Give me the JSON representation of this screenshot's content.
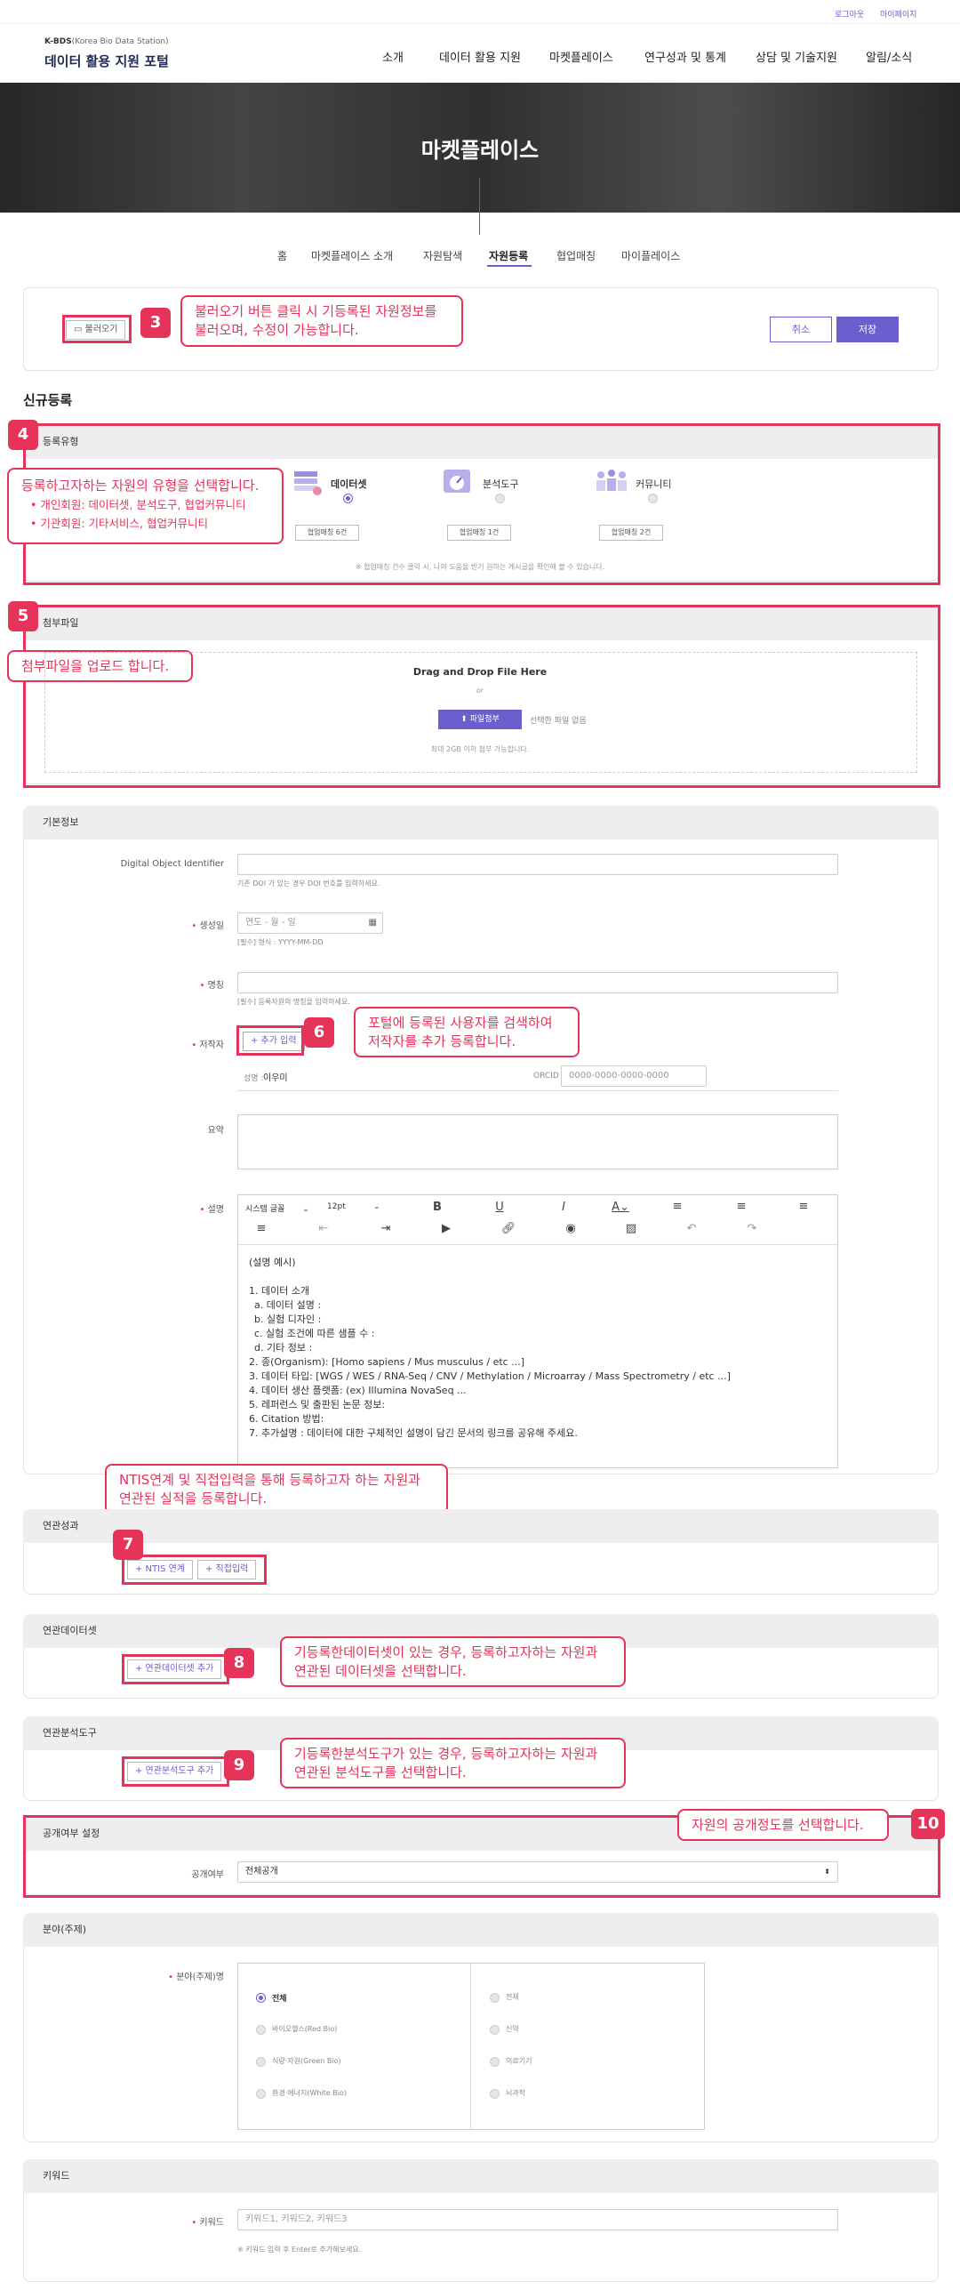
{
  "header": {
    "logout": "로그아웃",
    "mypage": "마이페이지",
    "brand_small": "K-BDS",
    "brand_sub": "(Korea Bio Data Station)",
    "brand_title": "데이터 활용 지원 포털",
    "nav": [
      "소개",
      "데이터 활용 지원",
      "마켓플레이스",
      "연구성과 및 통계",
      "상담 및 기술지원",
      "알림/소식"
    ]
  },
  "hero": {
    "title": "마켓플레이스"
  },
  "tabs": [
    "홈",
    "마켓플레이스 소개",
    "자원탐색",
    "자원등록",
    "협업매칭",
    "마이플레이스"
  ],
  "toolbar": {
    "load": "불러오기",
    "cancel": "취소",
    "save": "저장"
  },
  "callouts": {
    "c3": {
      "num": "3",
      "line1": "불러오기 버튼 클릭 시 기등록된 자원정보를",
      "line2": "불러오며, 수정이 가능합니다."
    },
    "c4": {
      "num": "4",
      "line1": "등록하고자하는 자원의 유형을 선택합니다.",
      "b1": "개인회원: 데이터셋, 분석도구, 협업커뮤니티",
      "b2": "기관회원: 기타서비스, 협업커뮤니티"
    },
    "c5": {
      "num": "5",
      "line1": "첨부파일을 업로드 합니다."
    },
    "c6": {
      "num": "6",
      "line1": "포털에 등록된 사용자를 검색하여",
      "line2": "저작자를 추가 등록합니다."
    },
    "c7": {
      "num": "7",
      "line1": "NTIS연계 및 직접입력을 통해 등록하고자 하는 자원과",
      "line2": "연관된 실적을 등록합니다."
    },
    "c8": {
      "num": "8",
      "line1": "기등록한데이터셋이 있는 경우, 등록하고자하는 자원과",
      "line2": "연관된 데이터셋을 선택합니다."
    },
    "c9": {
      "num": "9",
      "line1": "기등록한분석도구가 있는 경우, 등록하고자하는 자원과",
      "line2": "연관된 분석도구를 선택합니다."
    },
    "c10": {
      "num": "10",
      "line1": "자원의 공개정도를 선택합니다."
    }
  },
  "page_title": "신규등록",
  "reg_type": {
    "title": "등록유형",
    "items": [
      {
        "label": "데이터셋",
        "count": "협업매칭 6건"
      },
      {
        "label": "분석도구",
        "count": "협업매칭 1건"
      },
      {
        "label": "커뮤니티",
        "count": "협업매칭 2건"
      }
    ],
    "note": "※ 협업매칭 건수 클릭 시, 나의 도움을 받기 원하는 게시글을 확인해 볼 수 있습니다."
  },
  "attach": {
    "title": "첨부파일",
    "drag": "Drag and Drop File Here",
    "or": "or",
    "button": "파일첨부",
    "nofile": "선택한 파일 없음",
    "limit": "최대 2GB 이하 첨부 가능합니다."
  },
  "basic": {
    "title": "기본정보",
    "doi_label": "Digital Object Identifier",
    "doi_hint": "기존 DOI 가 있는 경우 DOI 번호를 입력하세요.",
    "date_label": "생성일",
    "date_ph": "연도 - 월 - 일",
    "date_hint": "[필수] 형식 : YYYY-MM-DD",
    "name_label": "명칭",
    "name_hint": "[필수] 등록자원의 명칭을 입력하세요.",
    "author_label": "저작자",
    "author_add": "+ 추가 입력",
    "author_name_label": "성명 :",
    "author_name": "이우미",
    "orcid_label": "ORCID :",
    "orcid_ph": "0000-0000-0000-0000",
    "summary_label": "요약",
    "desc_label": "설명",
    "editor_font": "시스템 글꼴",
    "editor_size": "12pt",
    "desc_lines": [
      "(설명 예시)",
      "",
      "1. 데이터 소개",
      "  a. 데이터 설명 :",
      "  b. 실험 디자인 :",
      "  c. 실험 조건에 따른 샘플 수 :",
      "  d. 기타 정보 :",
      "2. 종(Organism): [Homo sapiens / Mus musculus / etc ...]",
      "3. 데이터 타입: [WGS / WES / RNA-Seq / CNV / Methylation / Microarray / Mass Spectrometry / etc ...]",
      "4. 데이터 생산 플랫폼: (ex) Illumina NovaSeq ...",
      "5. 레퍼런스 및 출판된 논문 정보:",
      "6. Citation 방법:",
      "7. 추가설명 : 데이터에 대한 구체적인 설명이 담긴 문서의 링크를 공유해 주세요."
    ]
  },
  "perf": {
    "title": "연관성과",
    "ntis": "+ NTIS 연계",
    "direct": "+ 직접입력"
  },
  "rel_data": {
    "title": "연관데이터셋",
    "button": "+ 연관데이터셋 추가"
  },
  "rel_tool": {
    "title": "연관분석도구",
    "button": "+ 연관분석도구 추가"
  },
  "public": {
    "title": "공개여부 설정",
    "label": "공개여부",
    "value": "전체공개"
  },
  "field": {
    "title": "분야(주제)",
    "label": "분야(주제)명",
    "left": [
      "전체",
      "바이오헬스(Red Bio)",
      "식량·자원(Green Bio)",
      "환경·에너지(White Bio)"
    ],
    "right": [
      "전체",
      "신약",
      "의료기기",
      "뇌과학"
    ]
  },
  "keyword": {
    "title": "키워드",
    "label": "키워드",
    "ph": "키워드1, 키워드2, 키워드3",
    "hint": "※ 키워드 입력 후 Enter로 추가해보세요."
  },
  "colors": {
    "accent": "#6c5ecf",
    "callout": "#e5335a"
  }
}
